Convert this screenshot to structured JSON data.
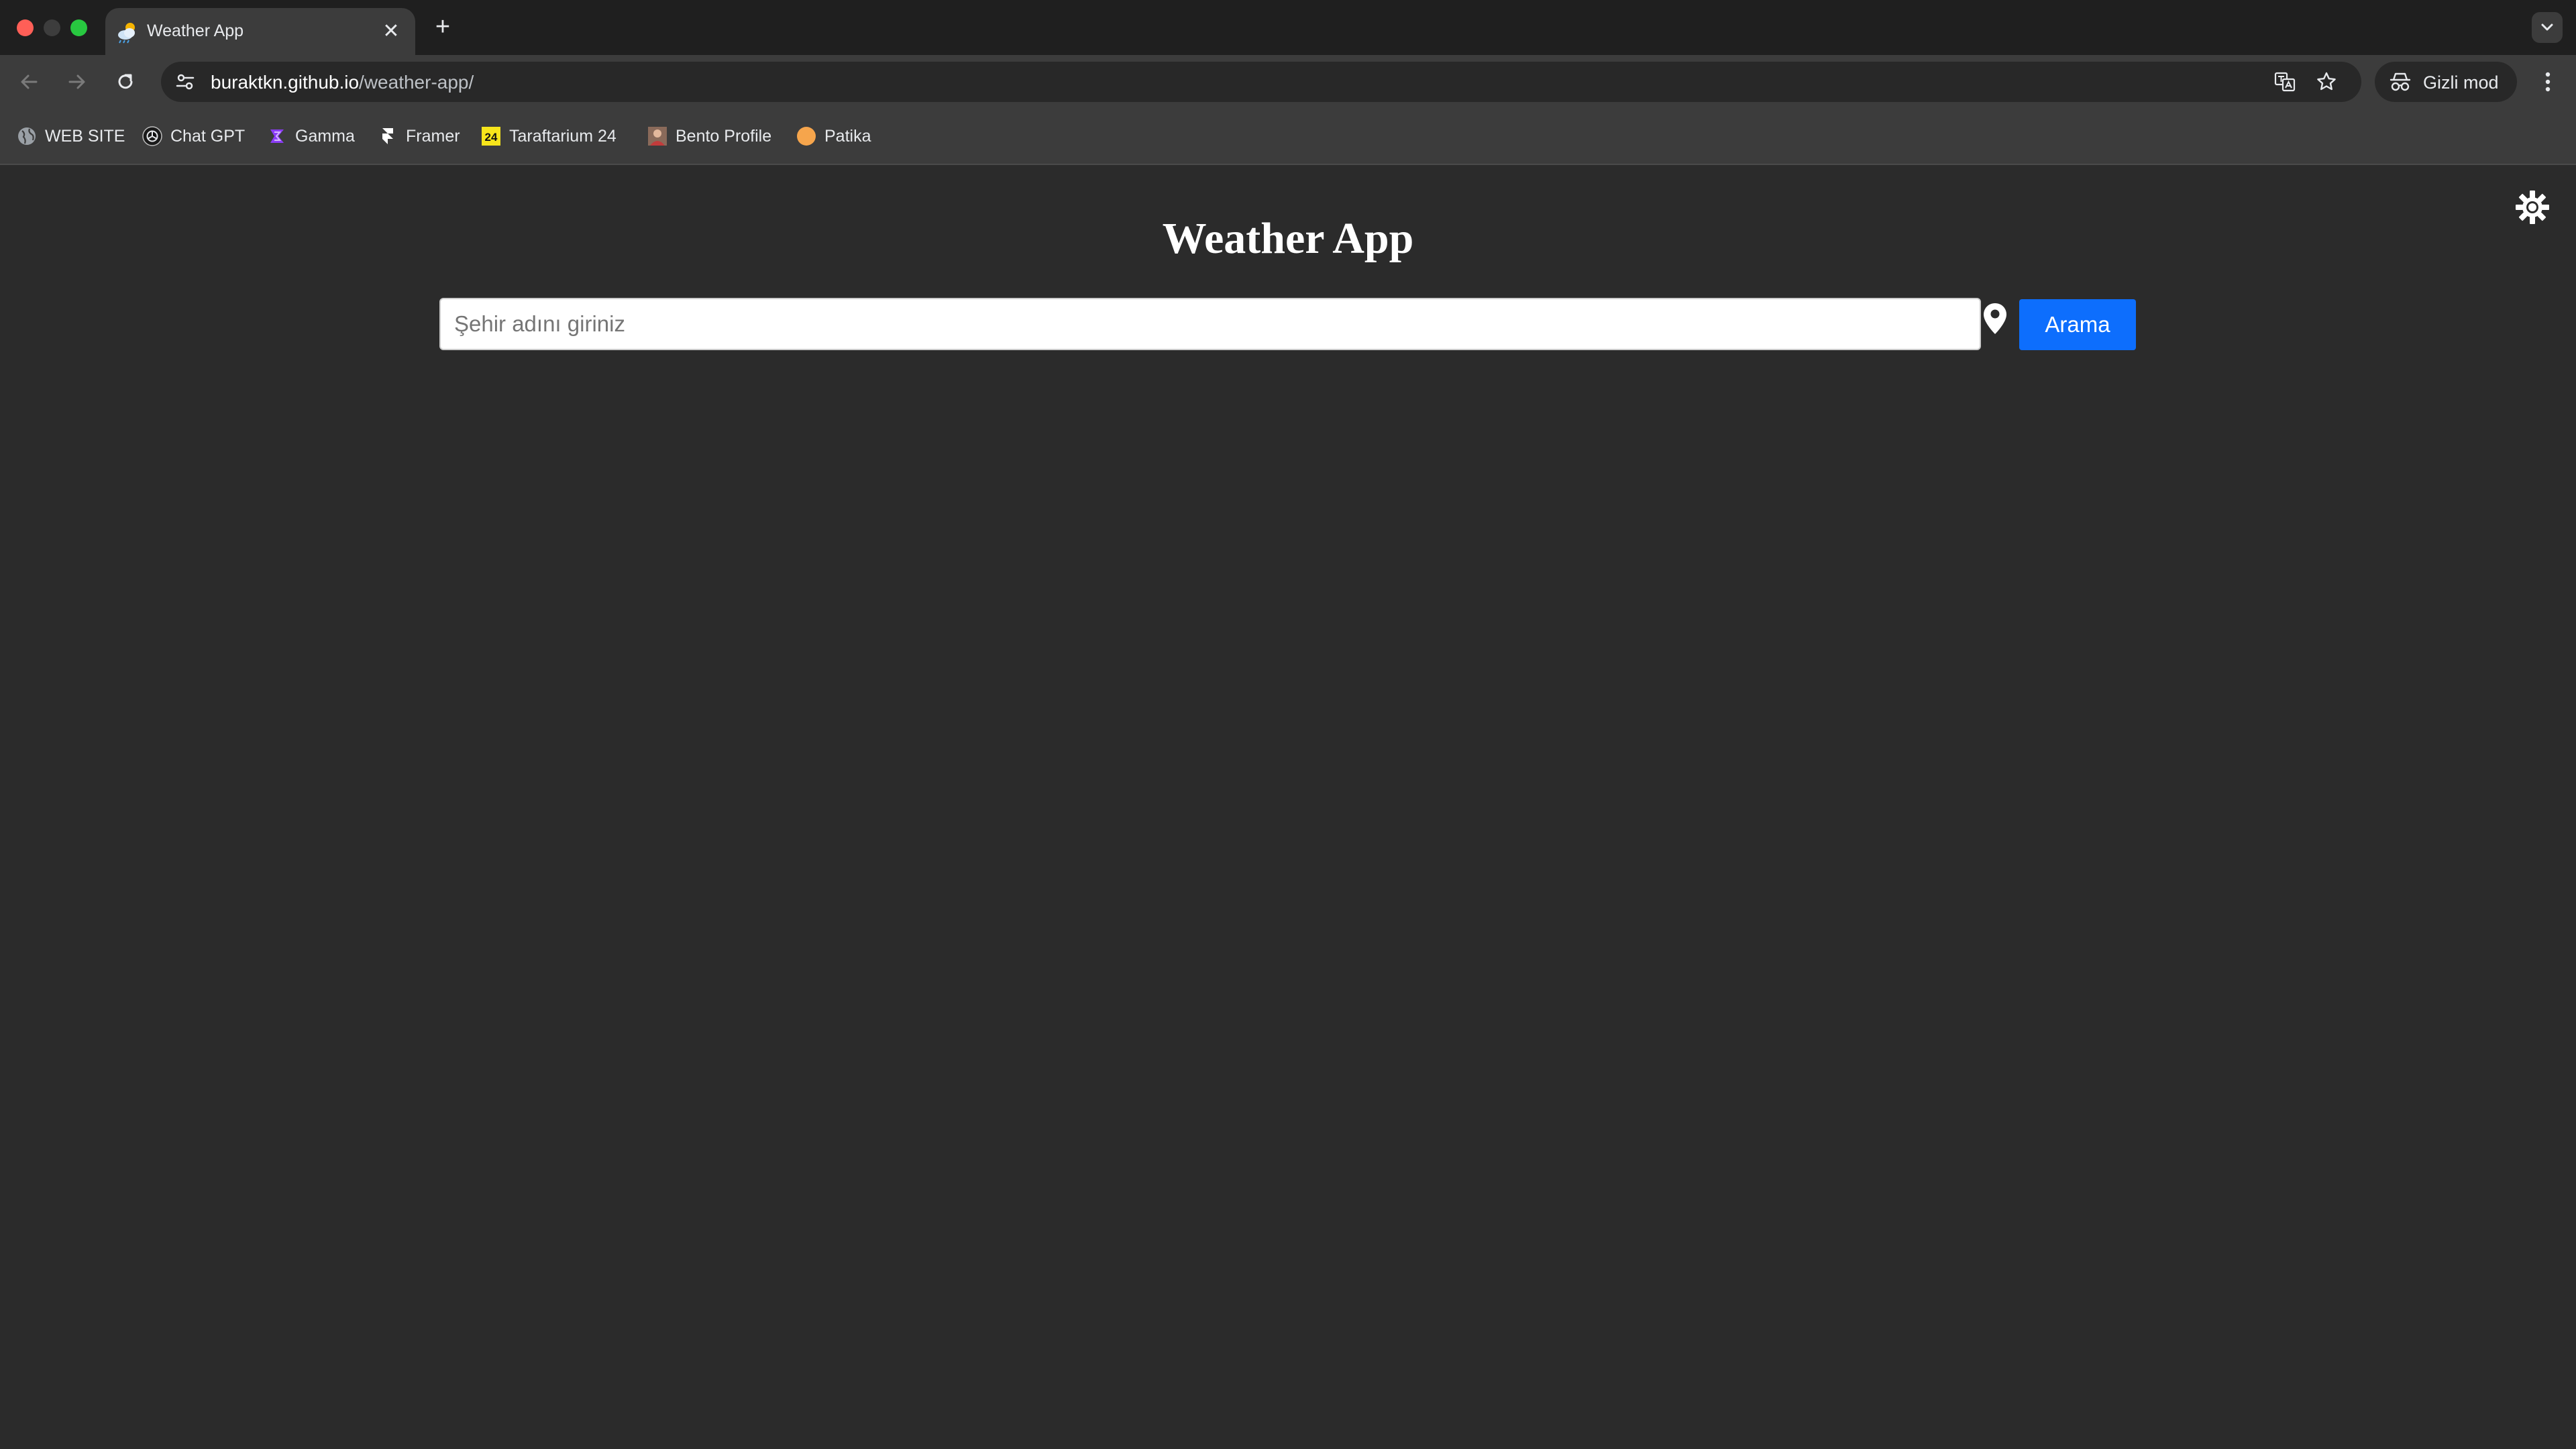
{
  "browser": {
    "tab": {
      "title": "Weather App",
      "favicon": "weather-cloud-sun-icon",
      "close_glyph": "✕"
    },
    "new_tab_glyph": "+",
    "address_bar": {
      "host": "buraktkn.github.io",
      "path": "/weather-app/"
    },
    "profile": {
      "label": "Gizli mod",
      "icon": "incognito-icon"
    },
    "bookmarks": [
      {
        "label": "WEB SITE",
        "icon": "globe-icon"
      },
      {
        "label": "Chat GPT",
        "icon": "chatgpt-icon"
      },
      {
        "label": "Gamma",
        "icon": "gamma-icon"
      },
      {
        "label": "Framer",
        "icon": "framer-icon"
      },
      {
        "label": "Taraftarium 24",
        "icon": "taraftarium-icon"
      },
      {
        "label": "Bento Profile",
        "icon": "bento-icon"
      },
      {
        "label": "Patika",
        "icon": "patika-icon"
      }
    ]
  },
  "app": {
    "title": "Weather App",
    "search": {
      "placeholder": "Şehir adını giriniz",
      "value": "",
      "button_label": "Arama"
    },
    "theme_icon": "sun-gear-icon"
  },
  "colors": {
    "page_background": "#2b2b2b",
    "accent": "#0d6efd",
    "title": "#ffffff"
  }
}
